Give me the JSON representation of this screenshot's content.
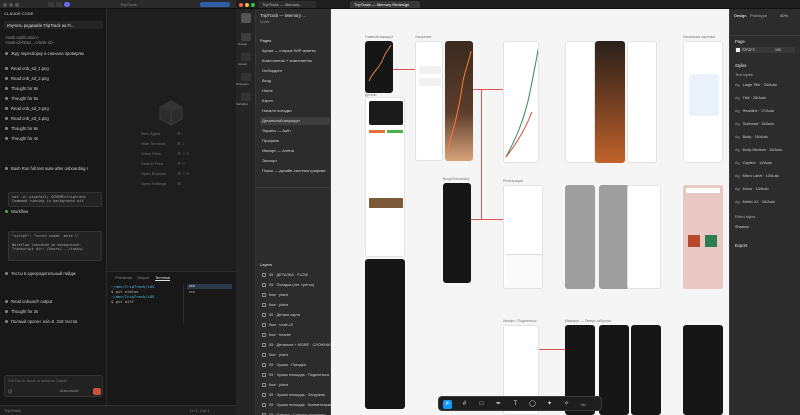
{
  "vscode": {
    "title": "TripTrack",
    "chat_header": "CLAUDE CODE",
    "chat_title": "Изучить редизайн TripTrack на Fi...",
    "rows": [
      {
        "text": "<task-notification>",
        "kind": "plain"
      },
      {
        "text": "<task-id>b0a1...</task-id>",
        "kind": "plain"
      },
      {
        "text": "Жду пересборку и сначала проверяю",
        "kind": "bullet"
      },
      {
        "text": "Read  onb_sd_1.png",
        "kind": "bullet"
      },
      {
        "text": "Read  onb_sd_2.png",
        "kind": "bullet"
      },
      {
        "text": "Thought for 8s",
        "kind": "bullet"
      },
      {
        "text": "Thought for 5s",
        "kind": "bullet"
      },
      {
        "text": "Read  onb_sd_3.png",
        "kind": "bullet"
      },
      {
        "text": "Read  onb_sd_4.png",
        "kind": "bullet"
      },
      {
        "text": "Thought for 6s",
        "kind": "bullet"
      },
      {
        "text": "Thought for 4s",
        "kind": "bullet"
      },
      {
        "text": "Bash  Run full test suite after onboarding r",
        "kind": "bullet"
      },
      {
        "text": "Workflow",
        "kind": "bullet-green"
      },
      {
        "text": "Тесты в однородительный пейдж",
        "kind": "bullet"
      },
      {
        "text": "Read  onboard*.output",
        "kind": "bullet"
      },
      {
        "text": "Thought for 3s",
        "kind": "bullet"
      },
      {
        "text": "Полный прогон: exit=0, 218 тестов",
        "kind": "bullet"
      }
    ],
    "code_1": [
      "set -e; pipefail; SCHEME=triptrack",
      "Command running in background wit"
    ],
    "code_2": [
      "\"script\": \"xcrun xcode -beta \\\"",
      "Workflow launched in background.",
      "Transcript dir: /Users/.../tasks/"
    ],
    "input_placeholder": "Ctrl Esc to focus or unfocus Claude",
    "accept_label": "Auto-mode",
    "menu": [
      {
        "label": "New Agent",
        "key": "⌘ I"
      },
      {
        "label": "Hide Terminal",
        "key": "⌘ J"
      },
      {
        "label": "Show Files",
        "key": "⌘ ⇧ E"
      },
      {
        "label": "Search Files",
        "key": "⌘ P"
      },
      {
        "label": "Open Browser",
        "key": "⌘ ⇧ B"
      },
      {
        "label": "Open Settings",
        "key": "⌘ ,"
      }
    ],
    "panel_tabs": [
      "Problems",
      "Output",
      "Terminal"
    ],
    "active_panel_tab": "Terminal",
    "terminal_lines": [
      "~/dev/TripTrack/iOS",
      "$ git status",
      "~/dev/TripTrack/iOS",
      "$ git diff"
    ],
    "terminal_side": [
      "zsh",
      "zsh"
    ],
    "status_left": "TripTrack",
    "status_right": "Ln 1, Col 1"
  },
  "figma": {
    "tabs": [
      "TripTrack — Memory...",
      "TripTrack — Memory Redesign"
    ],
    "file_title": "TripTrack — Memory ...",
    "file_sub": "Drafts",
    "rail": [
      "Design",
      "Assets",
      "Prototype",
      "Variables"
    ],
    "pages_header": "Pages",
    "pages": [
      "Архив — старые WIP макеты",
      "Компоненты + компоненты",
      "Онбординг",
      "Вход",
      "Home",
      "Карта",
      "Начало поездки",
      "Детальный маршрут",
      "Экраны — Auth",
      "Профиль",
      "Импорт — Алёна",
      "Экспорт",
      "Поиск — дизайн-система графики"
    ],
    "active_page_index": 7,
    "layers_header": "Layers",
    "layers": [
      "05 · ДЕТАЛКА · FLOW",
      "05 · Поездка (лет. третья)",
      "flow · plane",
      "flow · plane",
      "05 · Детали карта",
      "flow · route-v2",
      "flow · header",
      "05 · Детальна + MORE · СЛОЖНАЯ",
      "flow · plane",
      "05 · Чужая · Поездка",
      "05 · Чужая площадь · Поделиться",
      "flow · plane",
      "05 · Чужая площадь · Загрузить",
      "05 · Чужая площадь · Комментарии",
      "05 · Пленка · Сделать просмотр"
    ],
    "canvas_labels": [
      "Главный маршрут",
      "Ускорение",
      "Детали",
      "Вход/Onboarding",
      "Регистрация",
      "Импорт / Поделиться",
      "Маршрут — Теперь отбрутка",
      "Начальная карточка"
    ],
    "toolbar_icons": [
      "move-icon",
      "frame-icon",
      "rect-icon",
      "pen-icon",
      "text-icon",
      "comment-icon",
      "actions-icon",
      "ai-icon",
      "dev-mode-icon"
    ],
    "inspector": {
      "tabs": [
        "Design",
        "Prototype"
      ],
      "zoom": "40%",
      "page_label": "Page",
      "page_value": "F2F2F2",
      "page_opacity": "100",
      "styles_header": "Styles",
      "text_styles_header": "Text styles",
      "text_styles": [
        "Large Title · 34/Auto",
        "Title · 28/Auto",
        "Headline · 17/Auto",
        "Subhead · 15/Auto",
        "Body · 16/Auto",
        "Body Medium · 16/Auto",
        "Caption · 11/Auto",
        "Micro Label · 10/Auto",
        "Mono · 13/Auto",
        "Metric XL · 34/Auto"
      ],
      "effect_header": "Effect styles",
      "effects": [
        "Shadow"
      ],
      "export_label": "Export"
    }
  }
}
